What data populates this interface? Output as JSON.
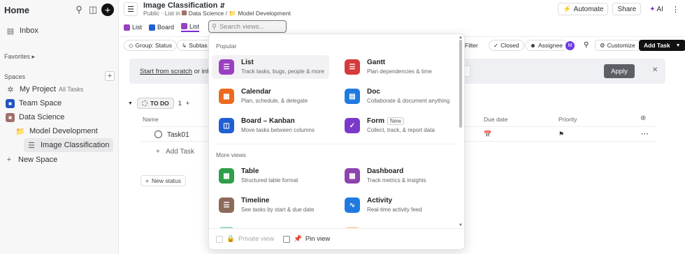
{
  "sidebar": {
    "home": "Home",
    "inbox": "Inbox",
    "favorites": "Favorites",
    "spaces": "Spaces",
    "items": [
      {
        "label": "My Project",
        "sub": "All Tasks"
      },
      {
        "label": "Team Space"
      },
      {
        "label": "Data Science"
      },
      {
        "label": "Model Development"
      },
      {
        "label": "Image Classification"
      },
      {
        "label": "New Space"
      }
    ]
  },
  "header": {
    "title": "Image Classification",
    "breadcrumb": {
      "visibility": "Public",
      "sep1": "List in",
      "space": "Data Science",
      "folder": "Model Development"
    },
    "automate": "Automate",
    "share": "Share",
    "ai": "AI"
  },
  "tabs": [
    {
      "label": "List"
    },
    {
      "label": "Board"
    },
    {
      "label": "List"
    }
  ],
  "search": {
    "placeholder": "Search views..."
  },
  "toolbar": {
    "group": "Group: Status",
    "subtasks": "Subtas",
    "filter": "Filter",
    "closed": "Closed",
    "assignee": "Assignee",
    "avatar": "M",
    "customize": "Customize",
    "add_task": "Add Task"
  },
  "banner": {
    "link": "Start from scratch",
    "rest": "or inhe",
    "apply": "Apply"
  },
  "list": {
    "status": "TO DO",
    "count": "1",
    "columns": {
      "name": "Name",
      "due": "Due date",
      "priority": "Priority"
    },
    "task": "Task01",
    "add_task": "Add Task",
    "new_status": "New status"
  },
  "dropdown": {
    "popular_label": "Popular",
    "more_label": "More views",
    "popular": [
      {
        "title": "List",
        "desc": "Track tasks, bugs, people & more",
        "color": "#9b3fc1"
      },
      {
        "title": "Gantt",
        "desc": "Plan dependencies & time",
        "color": "#d63b3b"
      },
      {
        "title": "Calendar",
        "desc": "Plan, schedule, & delegate",
        "color": "#ec6a1f"
      },
      {
        "title": "Doc",
        "desc": "Collaborate & document anything",
        "color": "#1f7ae0"
      },
      {
        "title": "Board – Kanban",
        "desc": "Move tasks between columns",
        "color": "#1f5fd1"
      },
      {
        "title": "Form",
        "desc": "Collect, track, & report data",
        "color": "#7b39c9",
        "badge": "New"
      }
    ],
    "more": [
      {
        "title": "Table",
        "desc": "Structured table format",
        "color": "#2f9e4a"
      },
      {
        "title": "Dashboard",
        "desc": "Track metrics & insights",
        "color": "#8e44ad"
      },
      {
        "title": "Timeline",
        "desc": "See tasks by start & due date",
        "color": "#8c6a5a"
      },
      {
        "title": "Activity",
        "desc": "Real-time activity feed",
        "color": "#1f7ae0"
      }
    ],
    "footer": {
      "private": "Private view",
      "pin": "Pin view"
    }
  }
}
